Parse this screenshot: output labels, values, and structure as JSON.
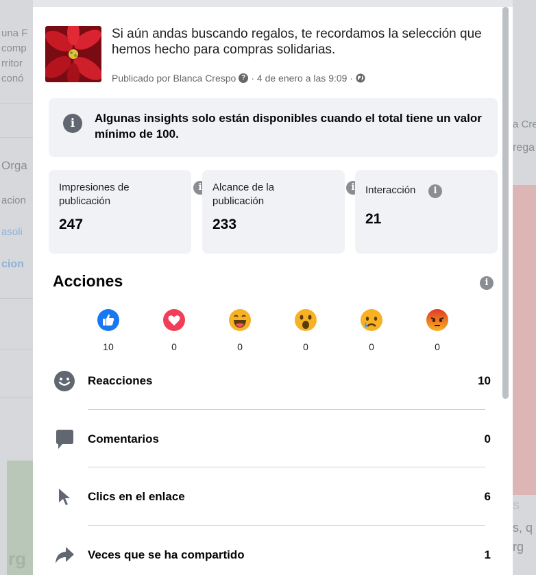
{
  "background": {
    "left_fragments": [
      "una F",
      "comp",
      "rritor",
      "conó",
      "Orga",
      "acion",
      "asoli",
      "cion",
      "rg"
    ],
    "right_fragments": [
      "a Cre",
      "rega",
      "S",
      "s, q",
      "rg"
    ]
  },
  "post": {
    "text": "Si aún andas buscando regalos, te recordamos la selección que hemos hecho para compras solidarias.",
    "meta_prefix": "Publicado por Blanca Crespo",
    "meta_date": "· 4 de enero a las 9:09 ·"
  },
  "notice": {
    "text": "Algunas insights solo están disponibles cuando el total tiene un valor mínimo de 100."
  },
  "stats": [
    {
      "label": "Impresiones de publicación",
      "value": "247"
    },
    {
      "label": "Alcance de la publicación",
      "value": "233"
    },
    {
      "label": "Interacción",
      "value": "21"
    }
  ],
  "actions": {
    "title": "Acciones",
    "reactions": [
      {
        "name": "like",
        "count": "10"
      },
      {
        "name": "love",
        "count": "0"
      },
      {
        "name": "haha",
        "count": "0"
      },
      {
        "name": "wow",
        "count": "0"
      },
      {
        "name": "sad",
        "count": "0"
      },
      {
        "name": "angry",
        "count": "0"
      }
    ],
    "rows": [
      {
        "label": "Reacciones",
        "value": "10",
        "icon": "smiley-icon"
      },
      {
        "label": "Comentarios",
        "value": "0",
        "icon": "comment-icon"
      },
      {
        "label": "Clics en el enlace",
        "value": "6",
        "icon": "cursor-icon"
      },
      {
        "label": "Veces que se ha compartido",
        "value": "1",
        "icon": "share-icon"
      }
    ]
  },
  "colors": {
    "like": "#1877f2",
    "love": "#f33e58",
    "emoji_yellow": "#f7b125",
    "angry": "#e9710f",
    "icon_gray": "#606770"
  }
}
